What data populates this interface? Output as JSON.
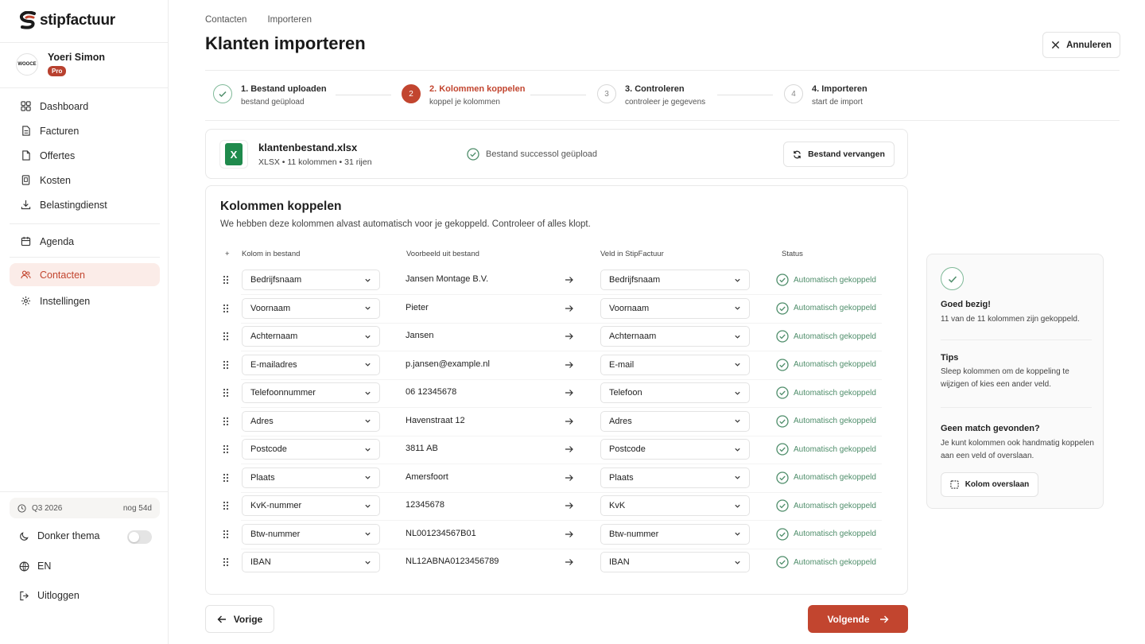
{
  "app": {
    "brand": "stipfactuur",
    "accent": "#c2452f",
    "success": "#4e8d6a"
  },
  "user": {
    "name": "Yoeri Simon",
    "badge": "Pro",
    "avatar_text": "WOOCE"
  },
  "sidebar": {
    "items": [
      {
        "label": "Dashboard",
        "icon": "grid-icon"
      },
      {
        "label": "Facturen",
        "icon": "document-icon"
      },
      {
        "label": "Offertes",
        "icon": "file-icon"
      },
      {
        "label": "Kosten",
        "icon": "receipt-icon"
      },
      {
        "label": "Belastingdienst",
        "icon": "download-icon"
      },
      {
        "label": "Agenda",
        "icon": "calendar-icon"
      },
      {
        "label": "Contacten",
        "icon": "users-icon",
        "active": true
      },
      {
        "label": "Instellingen",
        "icon": "gear-icon"
      }
    ],
    "quarter": {
      "label": "Q3 2026",
      "remaining": "nog 54d"
    },
    "dark_theme": {
      "label": "Donker thema",
      "enabled": false
    },
    "language": "EN",
    "logout": "Uitloggen"
  },
  "breadcrumb": [
    "Contacten",
    "Importeren"
  ],
  "page_title": "Klanten importeren",
  "cancel_label": "Annuleren",
  "steps": [
    {
      "title": "1. Bestand uploaden",
      "subtitle": "bestand geüpload",
      "state": "done",
      "number": "1"
    },
    {
      "title": "2. Kolommen koppelen",
      "subtitle": "koppel je kolommen",
      "state": "current",
      "number": "2"
    },
    {
      "title": "3. Controleren",
      "subtitle": "controleer je gegevens",
      "state": "upcoming",
      "number": "3"
    },
    {
      "title": "4. Importeren",
      "subtitle": "start de import",
      "state": "upcoming",
      "number": "4"
    }
  ],
  "file": {
    "name": "klantenbestand.xlsx",
    "meta": "XLSX • 11 kolommen • 31 rijen",
    "icon_letter": "X",
    "status": "Bestand successol geüpload",
    "replace_label": "Bestand vervangen"
  },
  "mapping": {
    "title": "Kolommen koppelen",
    "subtitle": "We hebben deze kolommen alvast automatisch voor je gekoppeld. Controleer of alles klopt.",
    "headers": {
      "drag": "+",
      "source": "Kolom in bestand",
      "sample": "Voorbeeld uit bestand",
      "target": "Veld in StipFactuur",
      "status": "Status"
    },
    "rows": [
      {
        "source": "Bedrijfsnaam",
        "sample": "Jansen Montage B.V.",
        "target": "Bedrijfsnaam",
        "status": "Automatisch gekoppeld"
      },
      {
        "source": "Voornaam",
        "sample": "Pieter",
        "target": "Voornaam",
        "status": "Automatisch gekoppeld"
      },
      {
        "source": "Achternaam",
        "sample": "Jansen",
        "target": "Achternaam",
        "status": "Automatisch gekoppeld"
      },
      {
        "source": "E-mailadres",
        "sample": "p.jansen@example.nl",
        "target": "E-mail",
        "status": "Automatisch gekoppeld"
      },
      {
        "source": "Telefoonnummer",
        "sample": "06 12345678",
        "target": "Telefoon",
        "status": "Automatisch gekoppeld"
      },
      {
        "source": "Adres",
        "sample": "Havenstraat 12",
        "target": "Adres",
        "status": "Automatisch gekoppeld"
      },
      {
        "source": "Postcode",
        "sample": "3811 AB",
        "target": "Postcode",
        "status": "Automatisch gekoppeld"
      },
      {
        "source": "Plaats",
        "sample": "Amersfoort",
        "target": "Plaats",
        "status": "Automatisch gekoppeld"
      },
      {
        "source": "KvK-nummer",
        "sample": "12345678",
        "target": "KvK",
        "status": "Automatisch gekoppeld"
      },
      {
        "source": "Btw-nummer",
        "sample": "NL001234567B01",
        "target": "Btw-nummer",
        "status": "Automatisch gekoppeld"
      },
      {
        "source": "IBAN",
        "sample": "NL12ABNA0123456789",
        "target": "IBAN",
        "status": "Automatisch gekoppeld"
      }
    ]
  },
  "nav": {
    "prev": "Vorige",
    "next": "Volgende"
  },
  "side_panel": {
    "title": "Goed bezig!",
    "summary": "11 van de 11 kolommen zijn gekoppeld.",
    "tips_title": "Tips",
    "tips_text": "Sleep kolommen om de koppeling te wijzigen of kies een ander veld.",
    "nomatch_title": "Geen match gevonden?",
    "nomatch_text": "Je kunt kolommen ook handmatig koppelen aan een veld of overslaan.",
    "skip_label": "Kolom overslaan"
  }
}
